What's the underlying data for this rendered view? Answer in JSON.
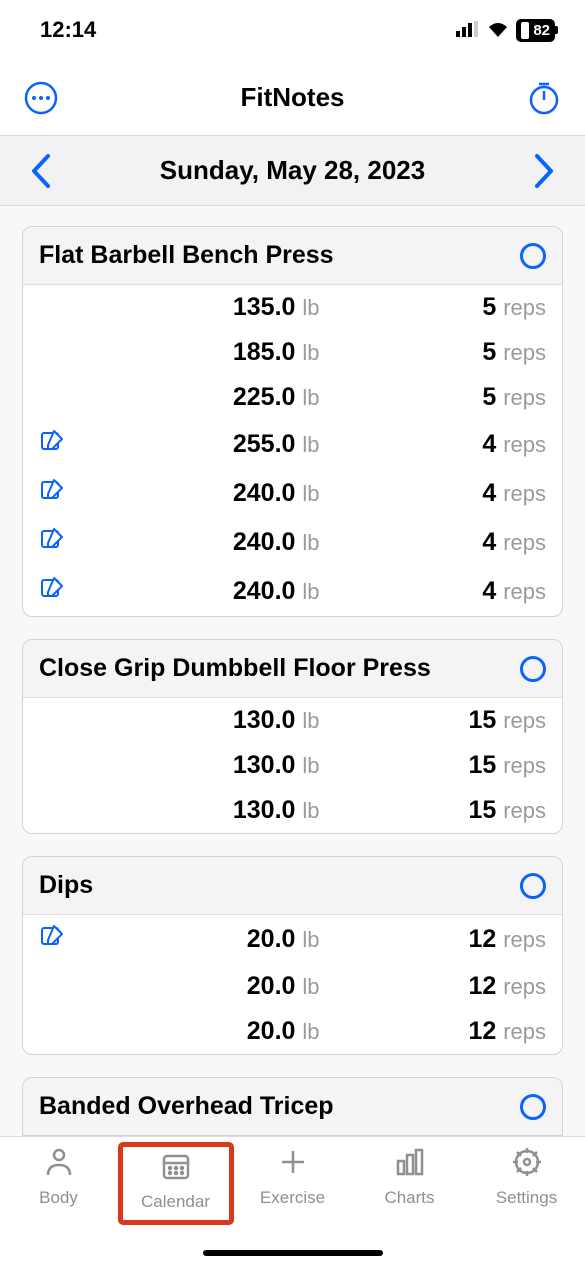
{
  "status": {
    "time": "12:14",
    "battery": "82"
  },
  "header": {
    "title": "FitNotes"
  },
  "date_nav": {
    "date": "Sunday, May 28, 2023"
  },
  "exercises": [
    {
      "name": "Flat Barbell Bench Press",
      "sets": [
        {
          "note": false,
          "weight": "135.0",
          "unit": "lb",
          "reps": "5",
          "reps_unit": "reps"
        },
        {
          "note": false,
          "weight": "185.0",
          "unit": "lb",
          "reps": "5",
          "reps_unit": "reps"
        },
        {
          "note": false,
          "weight": "225.0",
          "unit": "lb",
          "reps": "5",
          "reps_unit": "reps"
        },
        {
          "note": true,
          "weight": "255.0",
          "unit": "lb",
          "reps": "4",
          "reps_unit": "reps"
        },
        {
          "note": true,
          "weight": "240.0",
          "unit": "lb",
          "reps": "4",
          "reps_unit": "reps"
        },
        {
          "note": true,
          "weight": "240.0",
          "unit": "lb",
          "reps": "4",
          "reps_unit": "reps"
        },
        {
          "note": true,
          "weight": "240.0",
          "unit": "lb",
          "reps": "4",
          "reps_unit": "reps"
        }
      ]
    },
    {
      "name": "Close Grip Dumbbell Floor Press",
      "sets": [
        {
          "note": false,
          "weight": "130.0",
          "unit": "lb",
          "reps": "15",
          "reps_unit": "reps"
        },
        {
          "note": false,
          "weight": "130.0",
          "unit": "lb",
          "reps": "15",
          "reps_unit": "reps"
        },
        {
          "note": false,
          "weight": "130.0",
          "unit": "lb",
          "reps": "15",
          "reps_unit": "reps"
        }
      ]
    },
    {
      "name": "Dips",
      "sets": [
        {
          "note": true,
          "weight": "20.0",
          "unit": "lb",
          "reps": "12",
          "reps_unit": "reps"
        },
        {
          "note": false,
          "weight": "20.0",
          "unit": "lb",
          "reps": "12",
          "reps_unit": "reps"
        },
        {
          "note": false,
          "weight": "20.0",
          "unit": "lb",
          "reps": "12",
          "reps_unit": "reps"
        }
      ]
    }
  ],
  "partial_exercise": {
    "name": "Banded Overhead Tricep"
  },
  "tabs": {
    "body": "Body",
    "calendar": "Calendar",
    "exercise": "Exercise",
    "charts": "Charts",
    "settings": "Settings"
  }
}
